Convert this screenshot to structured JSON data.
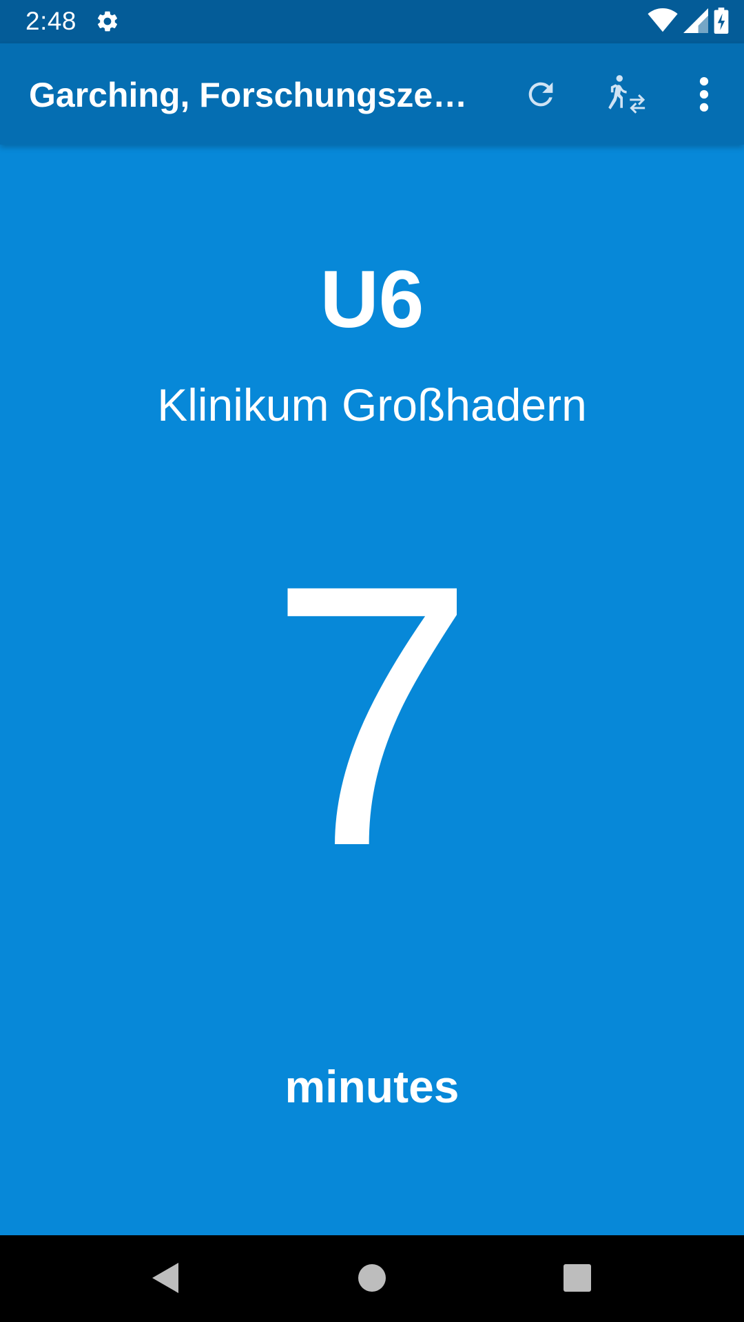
{
  "status_bar": {
    "time": "2:48",
    "settings_icon": "gear-icon",
    "wifi_icon": "wifi-icon",
    "signal_icon": "signal-icon",
    "battery_icon": "battery-charging-icon"
  },
  "app_bar": {
    "title": "Garching, Forschungszentrum",
    "actions": [
      {
        "icon": "refresh-icon"
      },
      {
        "icon": "walk-transfer-icon"
      },
      {
        "icon": "more-vert-icon"
      }
    ]
  },
  "departure": {
    "line": "U6",
    "destination": "Klinikum Großhadern",
    "minutes": "7",
    "unit": "minutes"
  },
  "nav_bar": {
    "back_icon": "back-icon",
    "home_icon": "home-icon",
    "recents_icon": "recents-icon"
  },
  "colors": {
    "background": "#0788d8",
    "app_bar": "#056eb2",
    "status_bar": "#045c98",
    "text": "#ffffff",
    "nav_bar": "#000000"
  }
}
